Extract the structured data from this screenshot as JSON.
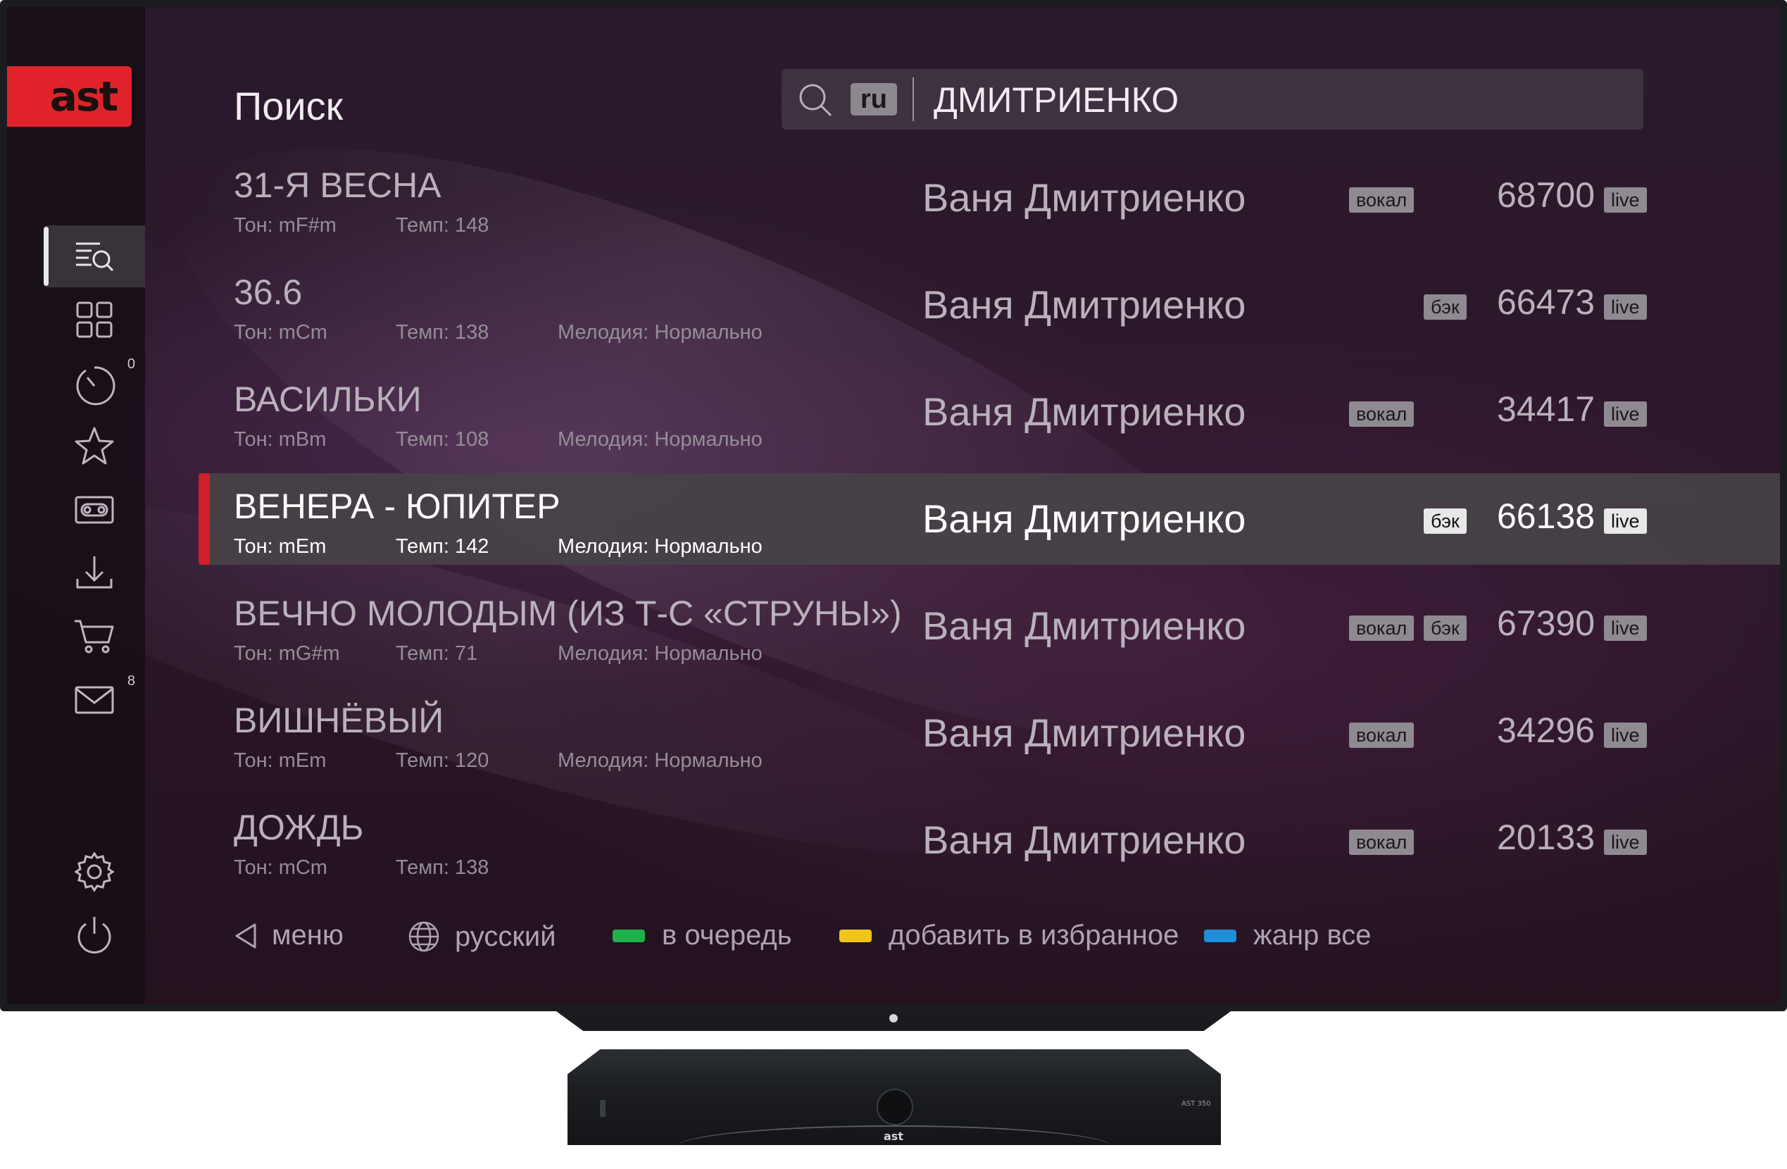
{
  "app": {
    "logo_text": "ast",
    "page_title": "Поиск",
    "colors": {
      "accent": "#d1202b",
      "green": "#1fb24a",
      "yellow": "#f0c419",
      "blue": "#1e8fd8"
    }
  },
  "sidebar": {
    "items": [
      {
        "name": "search",
        "icon": "search-list-icon",
        "active": true
      },
      {
        "name": "catalog",
        "icon": "grid-icon"
      },
      {
        "name": "queue",
        "icon": "timer-icon",
        "badge": "0"
      },
      {
        "name": "favorites",
        "icon": "star-icon"
      },
      {
        "name": "recordings",
        "icon": "cassette-icon"
      },
      {
        "name": "downloads",
        "icon": "download-icon"
      },
      {
        "name": "shop",
        "icon": "cart-icon"
      },
      {
        "name": "messages",
        "icon": "mail-icon",
        "badge": "8"
      },
      {
        "name": "settings",
        "icon": "gear-icon"
      },
      {
        "name": "power",
        "icon": "power-icon"
      }
    ]
  },
  "search": {
    "language": "ru",
    "query": "ДМИТРИЕНКО"
  },
  "songs": [
    {
      "title": "31-Я ВЕСНА",
      "ton": "Тон: mF#m",
      "tempo": "Темп: 148",
      "melody": "",
      "artist": "Ваня Дмитриенко",
      "vocal": "вокал",
      "back": "",
      "number": "68700",
      "live": "live",
      "selected": false
    },
    {
      "title": "36.6",
      "ton": "Тон: mCm",
      "tempo": "Темп: 138",
      "melody": "Мелодия: Нормально",
      "artist": "Ваня Дмитриенко",
      "vocal": "",
      "back": "бэк",
      "number": "66473",
      "live": "live",
      "selected": false
    },
    {
      "title": "ВАСИЛЬКИ",
      "ton": "Тон: mBm",
      "tempo": "Темп: 108",
      "melody": "Мелодия: Нормально",
      "artist": "Ваня Дмитриенко",
      "vocal": "вокал",
      "back": "",
      "number": "34417",
      "live": "live",
      "selected": false
    },
    {
      "title": "ВЕНЕРА - ЮПИТЕР",
      "ton": "Тон: mEm",
      "tempo": "Темп: 142",
      "melody": "Мелодия: Нормально",
      "artist": "Ваня Дмитриенко",
      "vocal": "",
      "back": "бэк",
      "number": "66138",
      "live": "live",
      "selected": true
    },
    {
      "title": "ВЕЧНО МОЛОДЫМ (ИЗ Т-С «СТРУНЫ»)",
      "ton": "Тон: mG#m",
      "tempo": "Темп: 71",
      "melody": "Мелодия: Нормально",
      "artist": "Ваня Дмитриенко",
      "vocal": "вокал",
      "back": "бэк",
      "number": "67390",
      "live": "live",
      "selected": false
    },
    {
      "title": "ВИШНЁВЫЙ",
      "ton": "Тон: mEm",
      "tempo": "Темп: 120",
      "melody": "Мелодия: Нормально",
      "artist": "Ваня Дмитриенко",
      "vocal": "вокал",
      "back": "",
      "number": "34296",
      "live": "live",
      "selected": false
    },
    {
      "title": "ДОЖДЬ",
      "ton": "Тон: mCm",
      "tempo": "Темп: 138",
      "melody": "",
      "artist": "Ваня Дмитриенко",
      "vocal": "вокал",
      "back": "",
      "number": "20133",
      "live": "live",
      "selected": false
    }
  ],
  "footer": {
    "menu": "меню",
    "language": "русский",
    "queue": "в очередь",
    "favorite": "добавить в избранное",
    "genre": "жанр все"
  },
  "device": {
    "logo_text": "ast",
    "model_text": "AST 350"
  }
}
